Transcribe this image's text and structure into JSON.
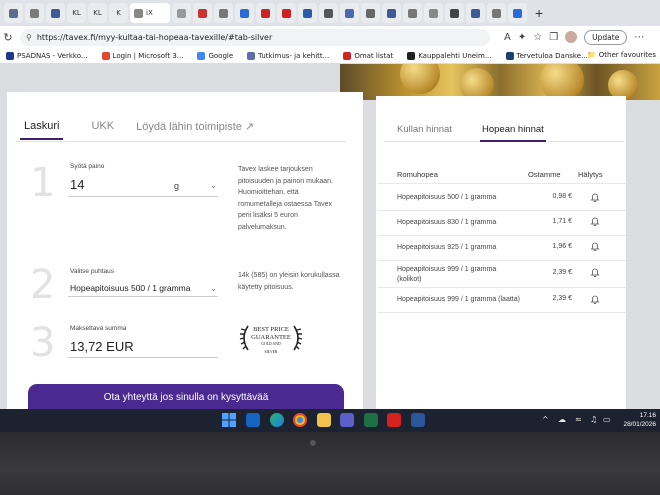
{
  "browser": {
    "tab_labels": [
      "iX",
      "KL",
      "KL",
      "K"
    ],
    "url": "https://tavex.fi/myy-kultaa-tai-hopeaa-tavexille/#tab-silver",
    "update_label": "Update",
    "read_aloud": "A",
    "bookmarks": [
      {
        "label": "PSADNAS - Verkko...",
        "color": "#1a3b8a"
      },
      {
        "label": "Login | Microsoft 3...",
        "color": "#e04a2c"
      },
      {
        "label": "Google",
        "color": "#4285f4"
      },
      {
        "label": "Tutkimus- ja kehitt...",
        "color": "#5b6ea8"
      },
      {
        "label": "Omat listat",
        "color": "#d02424"
      },
      {
        "label": "Kauppalehti Uneim...",
        "color": "#222222"
      },
      {
        "label": "Tervetuloa Danske...",
        "color": "#1b3f6e"
      }
    ],
    "other_favourites": "Other favourites"
  },
  "calculator": {
    "tabs": [
      "Laskuri",
      "UKK",
      "Löydä lähin toimipiste ↗"
    ],
    "step1": {
      "num": "1",
      "label": "Syötä paino",
      "value": "14",
      "unit": "g",
      "help": [
        "Tavex laskee tarjouksen",
        "pitoisuuden ja painon mukaan.",
        "Huomioittehan, että",
        "romumetalleja ostaessa Tavex",
        "perii lisäksi 5 euron",
        "palvelumaksun."
      ]
    },
    "step2": {
      "num": "2",
      "label": "Valitse puhtaus",
      "value": "Hopeapitoisuus 500 / 1 gramma",
      "help": [
        "14k (585) on yleisin korukullassa",
        "käytetty pitoisuus."
      ]
    },
    "step3": {
      "num": "3",
      "label": "Maksettava summa",
      "value": "13,72 EUR"
    },
    "badge": {
      "line1": "BEST PRICE",
      "line2": "GUARANTEE",
      "line3": "GOLD AND",
      "line4": "SILVER"
    },
    "cta": "Ota yhteyttä jos sinulla on kysyttävää"
  },
  "prices": {
    "tabs": [
      "Kullan hinnat",
      "Hopean hinnat"
    ],
    "headers": [
      "Romuhopea",
      "Ostamme",
      "Hälytys"
    ],
    "rows": [
      {
        "name": "Hopeapitoisuus 500 / 1 gramma",
        "name2": "",
        "price": "0,98 €"
      },
      {
        "name": "Hopeapitoisuus 830 / 1 gramma",
        "name2": "",
        "price": "1,71 €"
      },
      {
        "name": "Hopeapitoisuus 925 / 1 gramma",
        "name2": "",
        "price": "1,96 €"
      },
      {
        "name": "Hopeapitoisuus 999 / 1 gramma",
        "name2": "(kolikot)",
        "price": "2,39 €"
      },
      {
        "name": "Hopeapitoisuus 999 / 1 gramma (laatta)",
        "name2": "",
        "price": "2,39 €"
      }
    ]
  },
  "taskbar": {
    "time": "17.16",
    "date": "28/01/2026",
    "tray_arrow": "^"
  },
  "colors": {
    "accent": "#3d1f6e",
    "cta": "#4a2a90",
    "taskbar": "#1d2230"
  }
}
